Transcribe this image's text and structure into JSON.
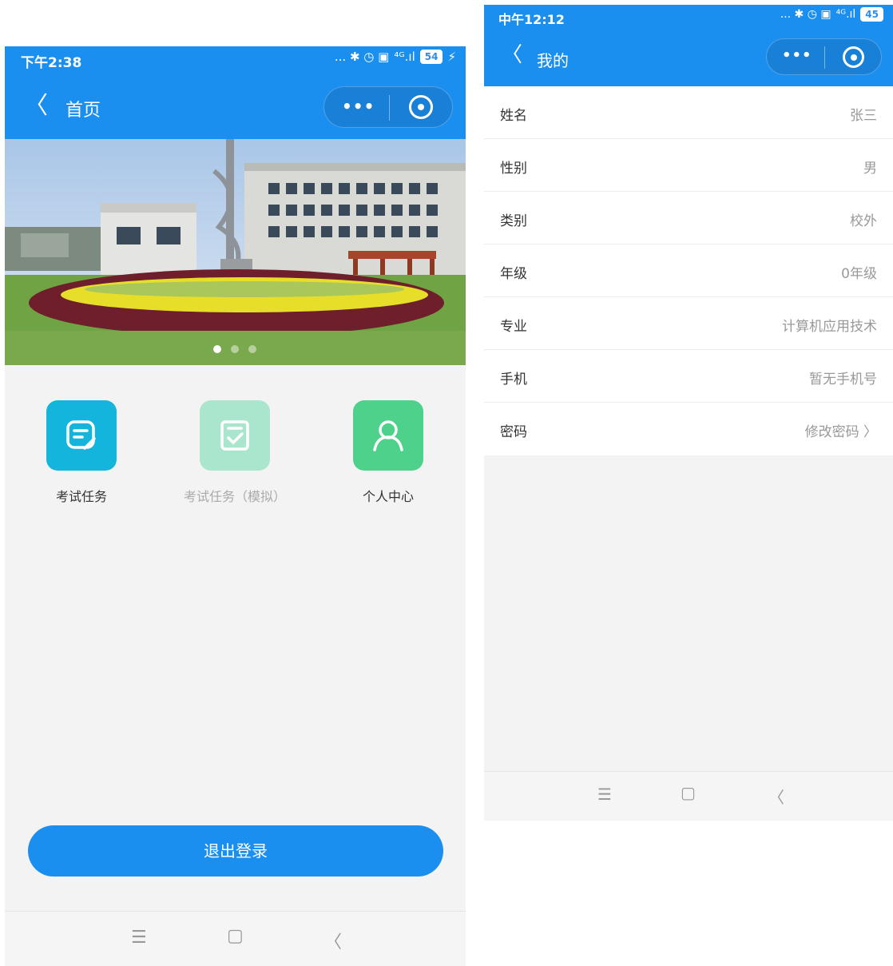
{
  "colors": {
    "brand_blue": "#1b8ff0",
    "page_bg": "#f3f3f3",
    "icon_cyan": "#13b5dd",
    "icon_mint": "#a9e6cd",
    "icon_green": "#4ed18a"
  },
  "left_screen": {
    "status_time": "下午2:38",
    "status_icons": "... ✱ ◷ ▣",
    "status_network": "⁴ᴳ.ıl",
    "battery": "54",
    "nav_back": "〈",
    "nav_title": "首页",
    "menu_dots": "•••",
    "banner_image": "campus-building-photo",
    "carousel": {
      "count": 3,
      "active_index": 0
    },
    "grid": [
      {
        "label": "考试任务",
        "icon": "edit-doc-icon",
        "enabled": true
      },
      {
        "label": "考试任务（模拟）",
        "icon": "check-doc-icon",
        "enabled": false
      },
      {
        "label": "个人中心",
        "icon": "person-icon",
        "enabled": true
      }
    ],
    "logout_label": "退出登录",
    "sys_nav": {
      "menu": "☰",
      "home": "▢",
      "back": "〈"
    }
  },
  "right_screen": {
    "status_time": "中午12:12",
    "status_icons": "... ✱ ◷ ▣",
    "status_network": "⁴ᴳ.ıl",
    "battery": "45",
    "nav_back": "〈",
    "nav_title": "我的",
    "menu_dots": "•••",
    "rows": [
      {
        "label": "姓名",
        "value": "张三"
      },
      {
        "label": "性别",
        "value": "男"
      },
      {
        "label": "类别",
        "value": "校外"
      },
      {
        "label": "年级",
        "value": "0年级"
      },
      {
        "label": "专业",
        "value": "计算机应用技术"
      },
      {
        "label": "手机",
        "value": "暂无手机号"
      },
      {
        "label": "密码",
        "value": "修改密码 〉"
      }
    ],
    "sys_nav": {
      "menu": "☰",
      "home": "▢",
      "back": "〈"
    }
  }
}
